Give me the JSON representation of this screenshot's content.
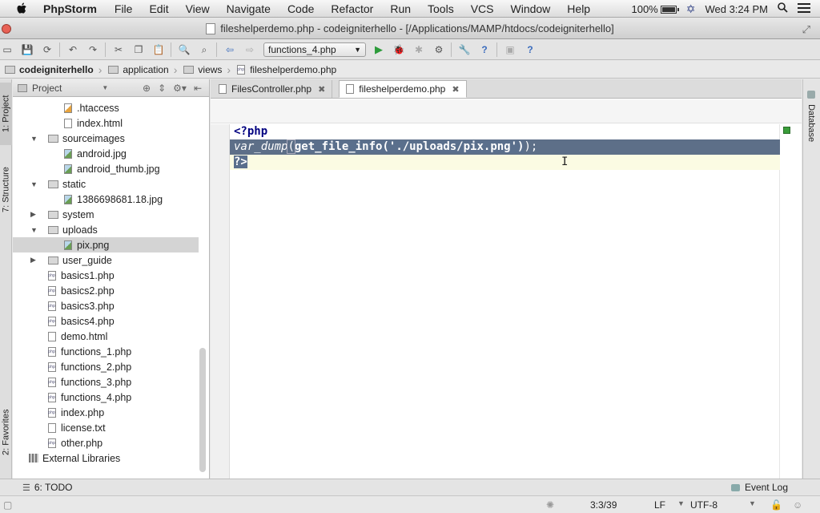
{
  "menubar": {
    "app": "PhpStorm",
    "items": [
      "File",
      "Edit",
      "View",
      "Navigate",
      "Code",
      "Refactor",
      "Run",
      "Tools",
      "VCS",
      "Window",
      "Help"
    ],
    "battery": "100%",
    "clock": "Wed 3:24 PM"
  },
  "window": {
    "title": "fileshelperdemo.php - codeigniterhello - [/Applications/MAMP/htdocs/codeigniterhello]"
  },
  "toolbar": {
    "run_config": "functions_4.php"
  },
  "breadcrumbs": [
    "codeigniterhello",
    "application",
    "views",
    "fileshelperdemo.php"
  ],
  "left_tabs": {
    "project": "1: Project",
    "structure": "7: Structure",
    "favorites": "2: Favorites"
  },
  "right_tabs": {
    "database": "Database"
  },
  "project_panel": {
    "title": "Project",
    "tree": [
      {
        "label": ".htaccess",
        "level": 3,
        "type": "htaccess"
      },
      {
        "label": "index.html",
        "level": 3,
        "type": "file"
      },
      {
        "label": "sourceimages",
        "level": 2,
        "type": "folder",
        "expanded": true
      },
      {
        "label": "android.jpg",
        "level": 3,
        "type": "img"
      },
      {
        "label": "android_thumb.jpg",
        "level": 3,
        "type": "img"
      },
      {
        "label": "static",
        "level": 2,
        "type": "folder",
        "expanded": true
      },
      {
        "label": "1386698681.18.jpg",
        "level": 3,
        "type": "img"
      },
      {
        "label": "system",
        "level": 2,
        "type": "folder",
        "expanded": false
      },
      {
        "label": "uploads",
        "level": 2,
        "type": "folder",
        "expanded": true
      },
      {
        "label": "pix.png",
        "level": 3,
        "type": "img",
        "selected": true
      },
      {
        "label": "user_guide",
        "level": 2,
        "type": "folder",
        "expanded": false
      },
      {
        "label": "basics1.php",
        "level": 2,
        "type": "php"
      },
      {
        "label": "basics2.php",
        "level": 2,
        "type": "php"
      },
      {
        "label": "basics3.php",
        "level": 2,
        "type": "php"
      },
      {
        "label": "basics4.php",
        "level": 2,
        "type": "php"
      },
      {
        "label": "demo.html",
        "level": 2,
        "type": "file"
      },
      {
        "label": "functions_1.php",
        "level": 2,
        "type": "php"
      },
      {
        "label": "functions_2.php",
        "level": 2,
        "type": "php"
      },
      {
        "label": "functions_3.php",
        "level": 2,
        "type": "php"
      },
      {
        "label": "functions_4.php",
        "level": 2,
        "type": "php"
      },
      {
        "label": "index.php",
        "level": 2,
        "type": "php"
      },
      {
        "label": "license.txt",
        "level": 2,
        "type": "file"
      },
      {
        "label": "other.php",
        "level": 2,
        "type": "php"
      },
      {
        "label": "External Libraries",
        "level": 1,
        "type": "lib"
      }
    ]
  },
  "editor": {
    "tabs": [
      {
        "label": "FilesController.php",
        "active": false
      },
      {
        "label": "fileshelperdemo.php",
        "active": true
      }
    ],
    "code": {
      "open_tag": "<?php",
      "fn": "var_dump",
      "paren_open": "(",
      "call": "get_file_info(",
      "string": "'./uploads/pix.png'",
      "call_close": ")",
      "tail": ");",
      "close_tag": "?>"
    }
  },
  "bottom": {
    "todo": "6: TODO",
    "event_log": "Event Log"
  },
  "status": {
    "position": "3:3/39",
    "line_sep": "LF",
    "encoding": "UTF-8"
  }
}
